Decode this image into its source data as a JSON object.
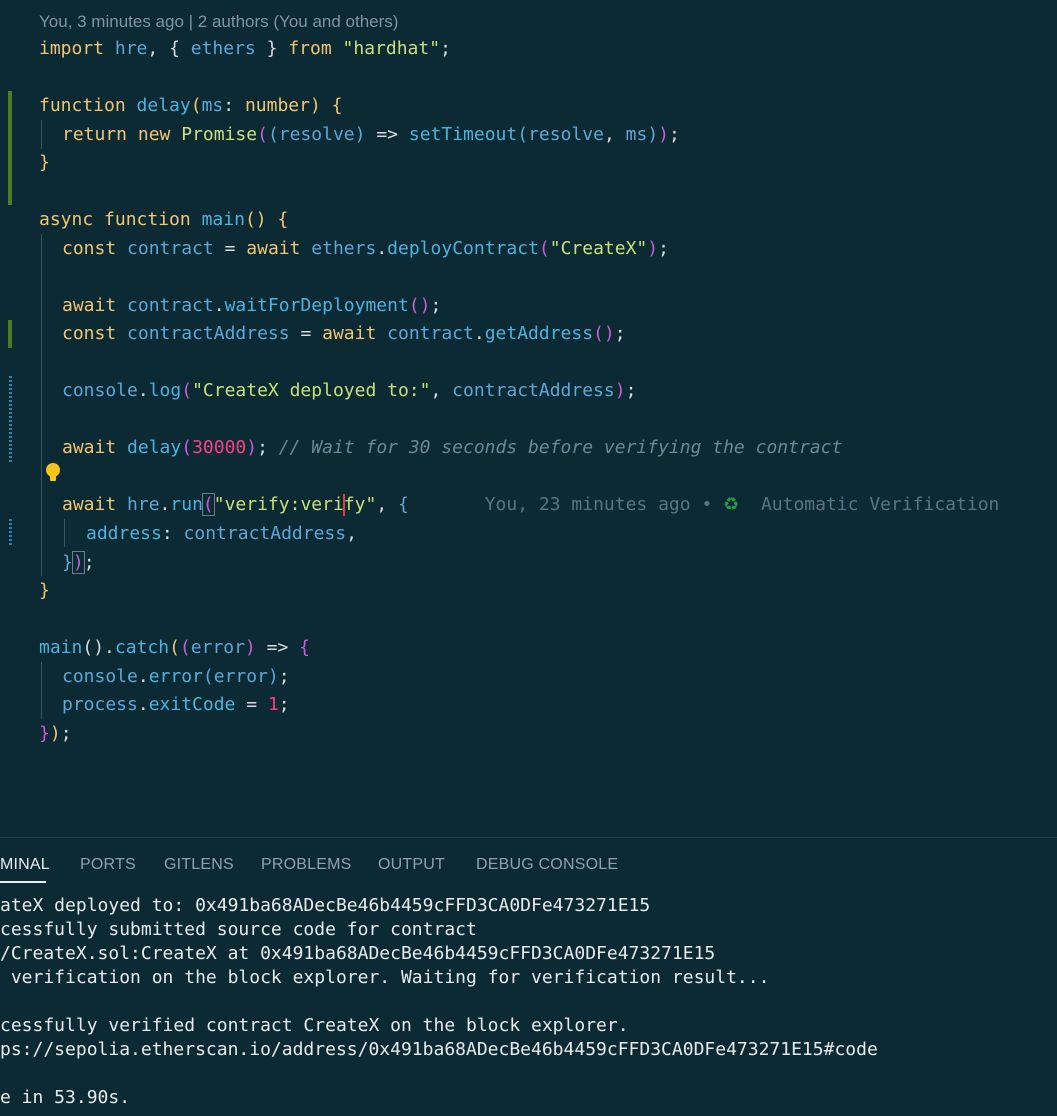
{
  "editor": {
    "blame_header": "You, 3 minutes ago | 2 authors (You and others)",
    "code": {
      "import_kw": "import",
      "import_name": "hre",
      "comma_brace": ", {",
      "import_ethers": "ethers",
      "close_brace": "}",
      "from_kw": "from",
      "import_src": "\"hardhat\"",
      "semicolon": ";",
      "fn_kw": "function",
      "delay_name": "delay",
      "ms_param": "ms",
      "number_type": "number",
      "return_kw": "return",
      "new_kw": "new",
      "promise_name": "Promise",
      "resolve_param": "resolve",
      "arrow": "=>",
      "settimeout_name": "setTimeout",
      "async_kw": "async",
      "main_name": "main",
      "const_kw": "const",
      "contract_var": "contract",
      "await_kw": "await",
      "deploy_fn": "deployContract",
      "createx_str": "\"CreateX\"",
      "wait_fn": "waitForDeployment",
      "address_var": "contractAddress",
      "getaddress_fn": "getAddress",
      "console_obj": "console",
      "log_fn": "log",
      "log_str": "\"CreateX deployed to:\"",
      "delay_ms": "30000",
      "comment": "// Wait for 30 seconds before verifying the contract",
      "hre_obj": "hre",
      "run_fn": "run",
      "verify_str_a": "\"verify:veri",
      "verify_str_b": "fy\"",
      "inline_blame": "You, 23 minutes ago • ",
      "inline_blame_msg": "Automatic Verification",
      "address_key": "address",
      "catch_fn": "catch",
      "error_param": "error",
      "error_fn": "error",
      "process_obj": "process",
      "exitcode_prop": "exitCode",
      "exit_value": "1",
      "recycle_glyph": "♻"
    }
  },
  "panel": {
    "tabs": [
      {
        "label": "MINAL",
        "active": true
      },
      {
        "label": "PORTS",
        "active": false
      },
      {
        "label": "GITLENS",
        "active": false
      },
      {
        "label": "PROBLEMS",
        "active": false
      },
      {
        "label": "OUTPUT",
        "active": false
      },
      {
        "label": "DEBUG CONSOLE",
        "active": false
      }
    ],
    "terminal_lines": [
      "ateX deployed to: 0x491ba68ADecBe46b4459cFFD3CA0DFe473271E15",
      "cessfully submitted source code for contract",
      "/CreateX.sol:CreateX at 0x491ba68ADecBe46b4459cFFD3CA0DFe473271E15",
      " verification on the block explorer. Waiting for verification result...",
      "",
      "cessfully verified contract CreateX on the block explorer.",
      "ps://sepolia.etherscan.io/address/0x491ba68ADecBe46b4459cFFD3CA0DFe473271E15#code",
      "",
      "e in 53.90s."
    ]
  },
  "colors": {
    "background": "#0c2a33",
    "keyword": "#f0c674",
    "function": "#4cb3e0",
    "string": "#c8e07c",
    "number": "#ff3e86"
  }
}
